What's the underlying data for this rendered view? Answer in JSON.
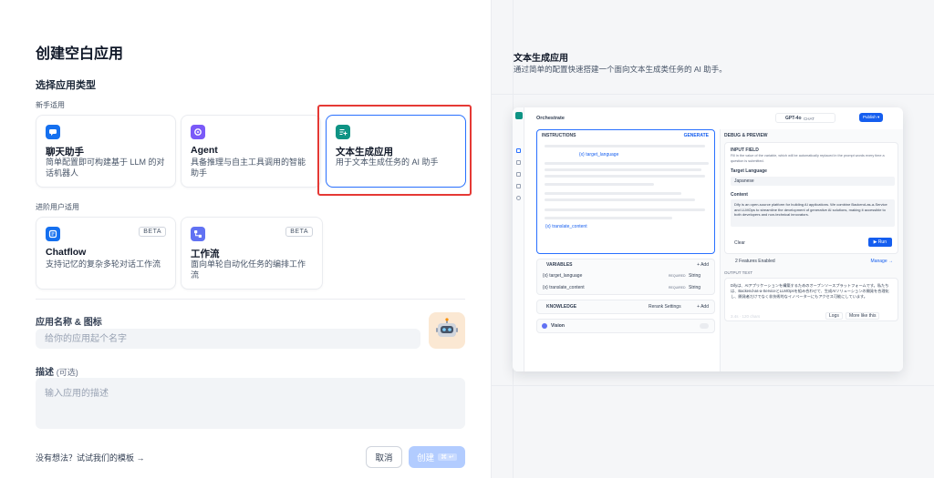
{
  "page": {
    "title": "创建空白应用",
    "section_app_type": "选择应用类型",
    "group_beginner": "新手适用",
    "group_advanced": "进阶用户适用"
  },
  "cards": [
    {
      "name": "聊天助手",
      "desc": "简单配置即可构建基于 LLM 的对话机器人",
      "icon": "chat-bubble-icon",
      "color": "#1570ef",
      "beta": ""
    },
    {
      "name": "Agent",
      "desc": "具备推理与自主工具调用的智能助手",
      "icon": "agent-icon",
      "color": "#7a5af8",
      "beta": ""
    },
    {
      "name": "文本生成应用",
      "desc": "用于文本生成任务的 AI 助手",
      "icon": "text-generate-icon",
      "color": "#0e9384",
      "beta": ""
    },
    {
      "name": "Chatflow",
      "desc": "支持记忆的复杂多轮对话工作流",
      "icon": "chatflow-icon",
      "color": "#1570ef",
      "beta": "BETA"
    },
    {
      "name": "工作流",
      "desc": "面向单轮自动化任务的编排工作流",
      "icon": "workflow-icon",
      "color": "#6172f3",
      "beta": "BETA"
    }
  ],
  "form": {
    "name_label": "应用名称 & 图标",
    "name_placeholder": "给你的应用起个名字",
    "desc_label": "描述",
    "desc_optional": "(可选)",
    "desc_placeholder": "输入应用的描述",
    "avatar_icon": "robot-icon"
  },
  "footer": {
    "template_link": "没有想法？试试我们的模板 →",
    "cancel": "取消",
    "create": "创建",
    "shortcut": "⌘ ↵"
  },
  "preview_panel": {
    "title": "文本生成应用",
    "desc": "通过简单的配置快速搭建一个面向文本生成类任务的 AI 助手。"
  },
  "preview": {
    "header_title": "Orchestrate",
    "model": "GPT-4o",
    "model_tag": "CHAT",
    "publish": "Publish ▾",
    "instructions_label": "INSTRUCTIONS",
    "generate": "GENERATE",
    "var_target": "{x} target_language",
    "var_translate": "{x} translate_content",
    "variables_label": "VARIABLES",
    "add": "+ Add",
    "variables": [
      {
        "name": "{x} target_language",
        "req": "REQUIRED",
        "type": "String"
      },
      {
        "name": "{x} translate_content",
        "req": "REQUIRED",
        "type": "String"
      }
    ],
    "knowledge_label": "KNOWLEDGE",
    "rerank": "Rerank Settings",
    "vision_label": "Vision",
    "debug_label": "DEBUG & PREVIEW",
    "input_field": "INPUT FIELD",
    "input_hint": "Fill in the value of the variable, which will be automatically replaced in the prompt words every time a question is submitted.",
    "target_language_label": "Target Language",
    "target_language_value": "Japanese",
    "content_label": "Content",
    "content_value": "Dify is an open-source platform for building AI applications. We combine Backend-as-a-Service and LLMOps to streamline the development of generative AI solutions, making it accessible to both developers and non-technical innovators.",
    "clear": "Clear",
    "run": "▶ Run",
    "features": "2 Features Enabled",
    "manage": "Manage →",
    "output_text": "OUTPUT TEXT",
    "output": "Difyは、AIアプリケーションを構築するためのオープンソースプラットフォームです。私たちは、Backend-as-a-ServiceとLLMOpsを組み合わせて、生成AIソリューションの開発を合理化し、開発者だけでなく非技術的なイノベーターにもアクセス可能にしています。",
    "logs": "Logs",
    "more_like": "More like this",
    "stats": "3.4s · 120 chars"
  }
}
